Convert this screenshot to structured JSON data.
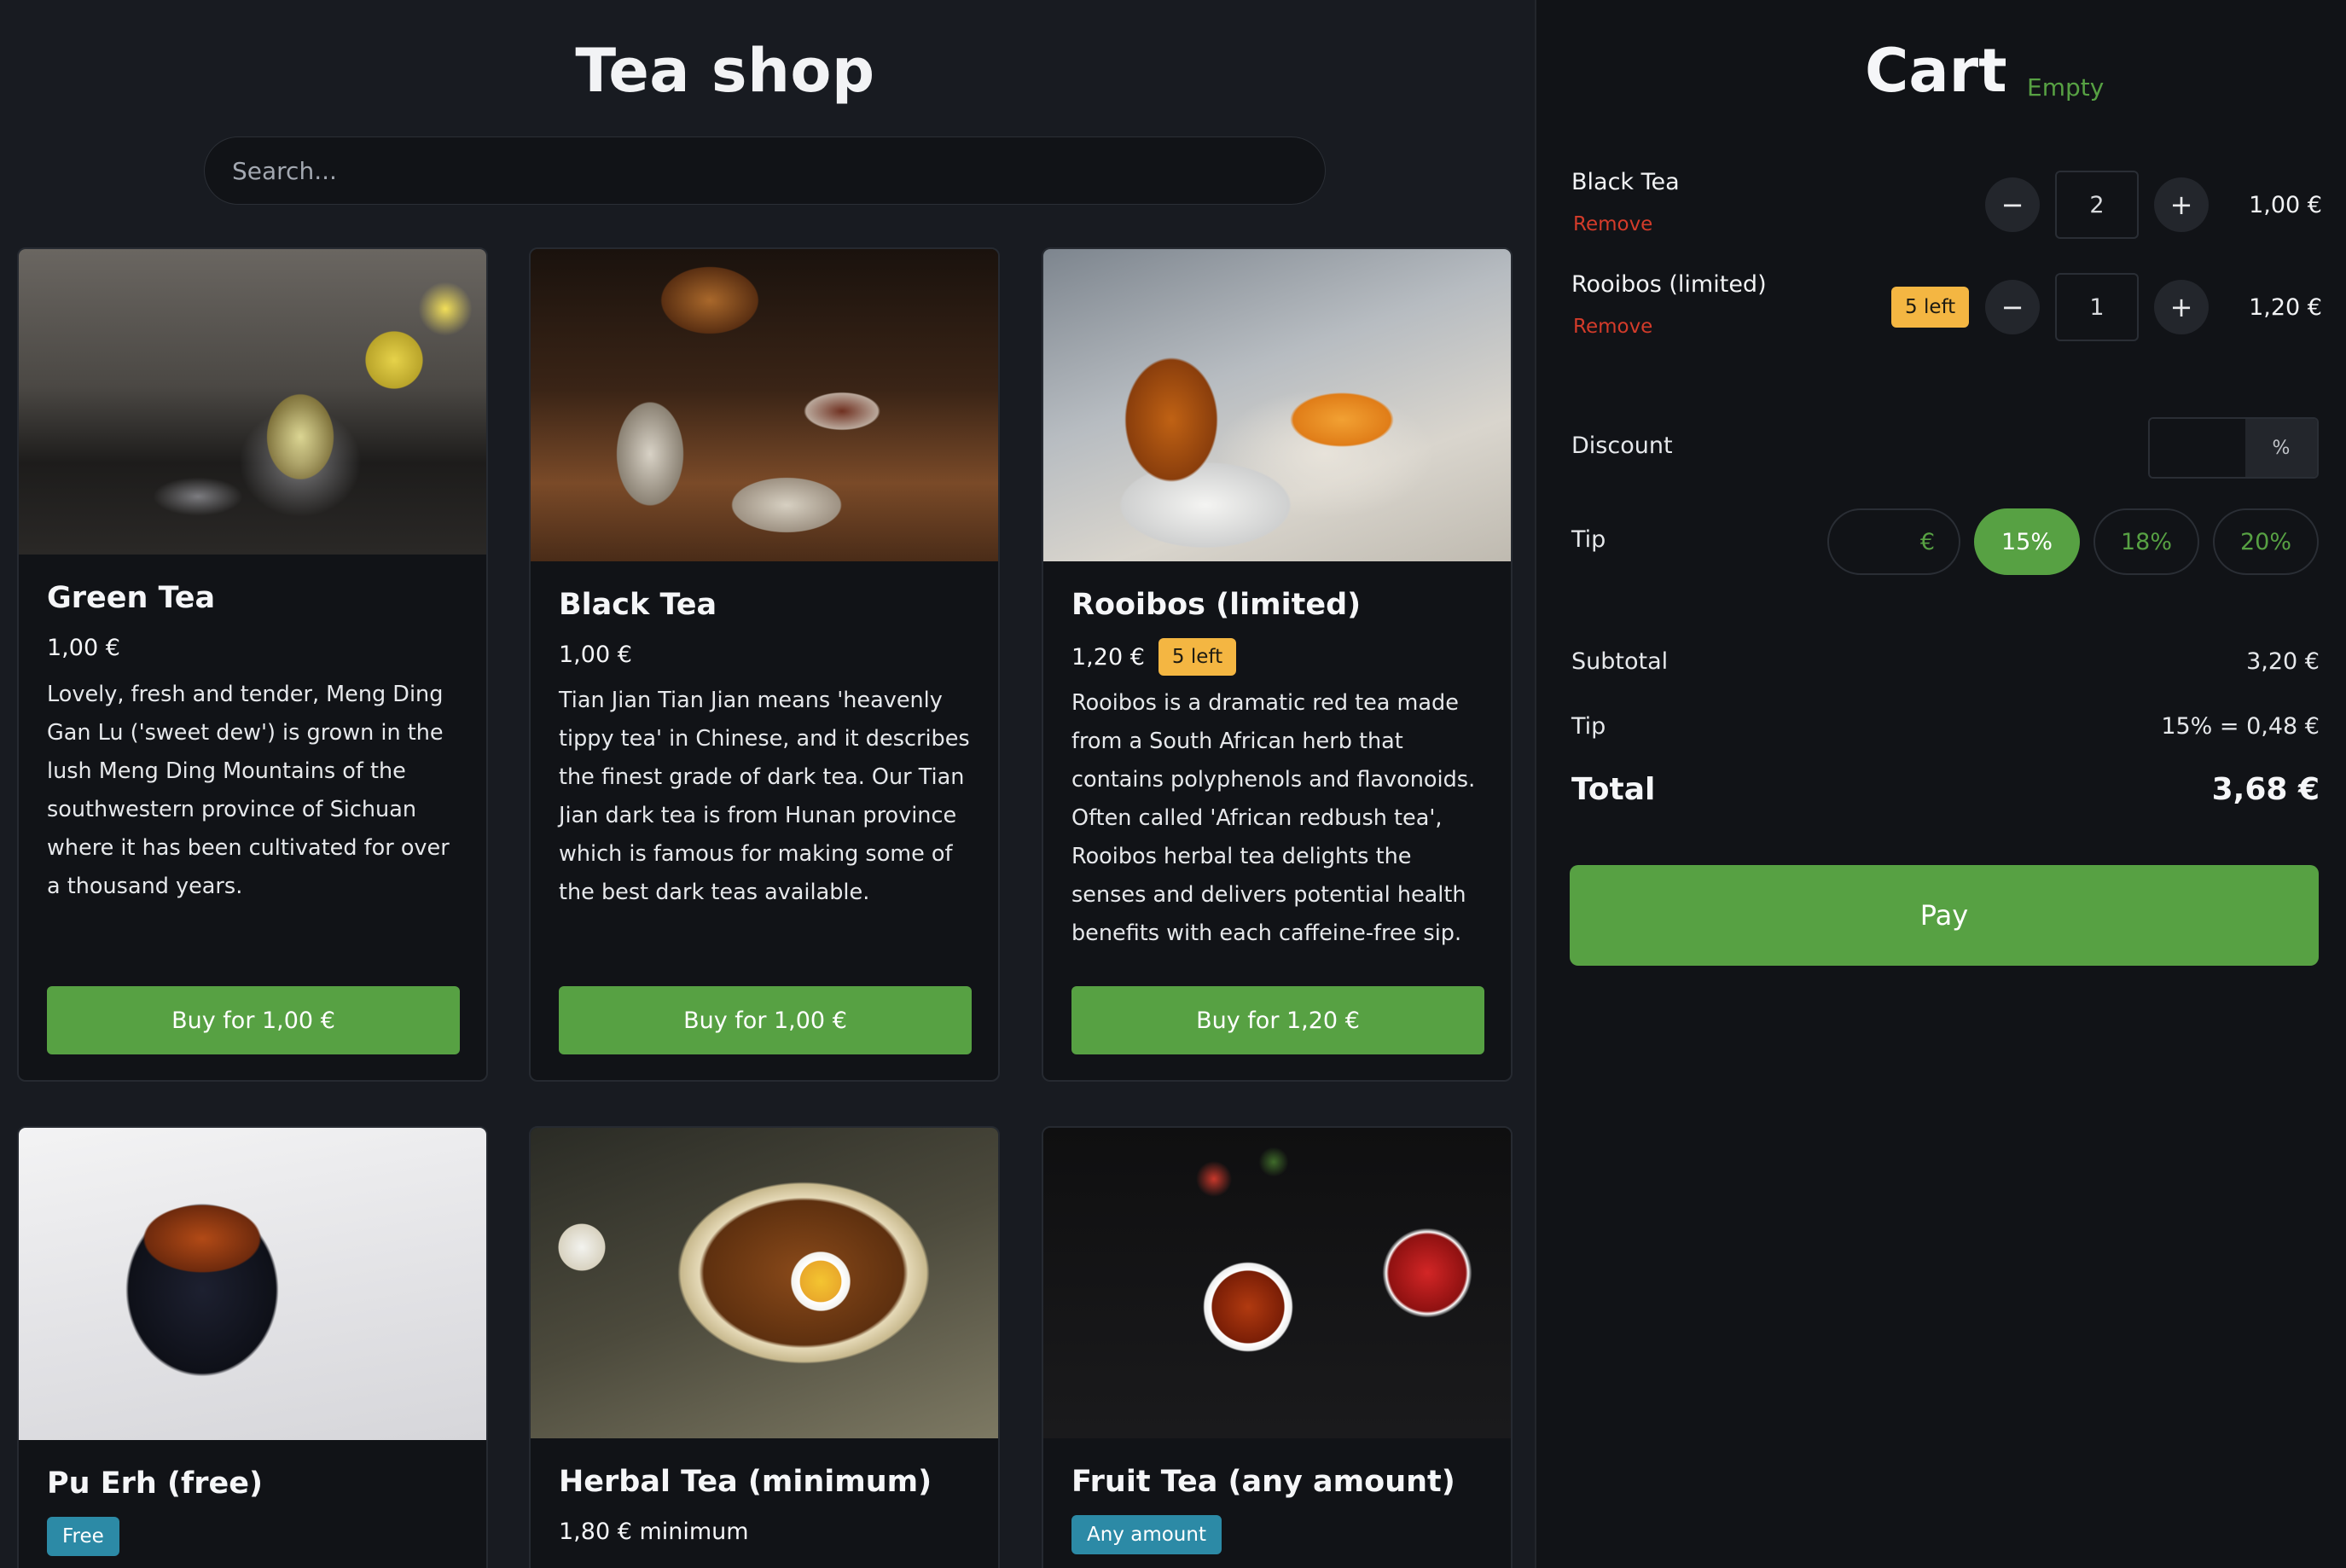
{
  "shop": {
    "title": "Tea shop",
    "search_placeholder": "Search..."
  },
  "products": [
    {
      "name": "Green Tea",
      "price": "1,00 €",
      "description": "Lovely, fresh and tender, Meng Ding Gan Lu ('sweet dew') is grown in the lush Meng Ding Mountains of the southwestern province of Sichuan where it has been cultivated for over a thousand years.",
      "buy_label": "Buy for 1,00 €"
    },
    {
      "name": "Black Tea",
      "price": "1,00 €",
      "description": "Tian Jian Tian Jian means 'heavenly tippy tea' in Chinese, and it describes the finest grade of dark tea. Our Tian Jian dark tea is from Hunan province which is famous for making some of the best dark teas available.",
      "buy_label": "Buy for 1,00 €"
    },
    {
      "name": "Rooibos (limited)",
      "price": "1,20 €",
      "stock_badge": "5 left",
      "description": "Rooibos is a dramatic red tea made from a South African herb that contains polyphenols and flavonoids. Often called 'African redbush tea', Rooibos herbal tea delights the senses and delivers potential health benefits with each caffeine-free sip.",
      "buy_label": "Buy for 1,20 €"
    },
    {
      "name": "Pu Erh (free)",
      "badge": "Free"
    },
    {
      "name": "Herbal Tea (minimum)",
      "price": "1,80 € minimum"
    },
    {
      "name": "Fruit Tea (any amount)",
      "badge": "Any amount"
    }
  ],
  "cart": {
    "title": "Cart",
    "empty_label": "Empty",
    "items": [
      {
        "name": "Black Tea",
        "remove_label": "Remove",
        "quantity": "2",
        "price": "1,00 €",
        "minus_icon": "−",
        "plus_icon": "+"
      },
      {
        "name": "Rooibos (limited)",
        "remove_label": "Remove",
        "stock_badge": "5 left",
        "quantity": "1",
        "price": "1,20 €",
        "minus_icon": "−",
        "plus_icon": "+"
      }
    ],
    "discount": {
      "label": "Discount",
      "value": "",
      "unit": "%"
    },
    "tip": {
      "label": "Tip",
      "custom_unit": "€",
      "options": [
        "15%",
        "18%",
        "20%"
      ],
      "selected": "15%"
    },
    "summary": {
      "subtotal_label": "Subtotal",
      "subtotal_value": "3,20 €",
      "tip_label": "Tip",
      "tip_value": "15% = 0,48 €",
      "total_label": "Total",
      "total_value": "3,68 €"
    },
    "pay_label": "Pay"
  },
  "colors": {
    "accent_green": "#57a143",
    "badge_amber": "#f4b642",
    "badge_teal": "#2c8aa6",
    "remove_red": "#d33b2a"
  }
}
